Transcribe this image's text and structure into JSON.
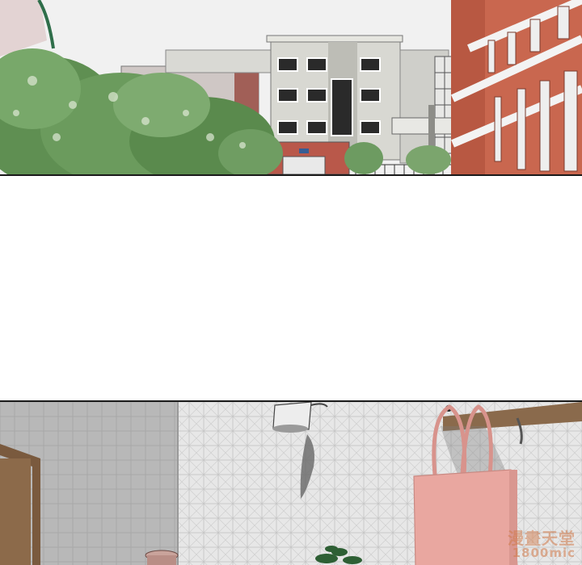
{
  "panels": [
    {
      "scene": "building-exterior"
    },
    {
      "scene": "empty-gutter"
    },
    {
      "scene": "kitchen-interior"
    }
  ],
  "colors": {
    "sky": "#f1f1f1",
    "brick": "#c9674f",
    "concrete": "#cfcfc9",
    "foliage": "#5f8f52",
    "tile_wall": "#e6e6e6",
    "gray_wall": "#b9b9b9",
    "bag_pink": "#e9a7a0"
  },
  "watermark": {
    "line1": "漫畫天堂",
    "line2": "1800mic"
  }
}
